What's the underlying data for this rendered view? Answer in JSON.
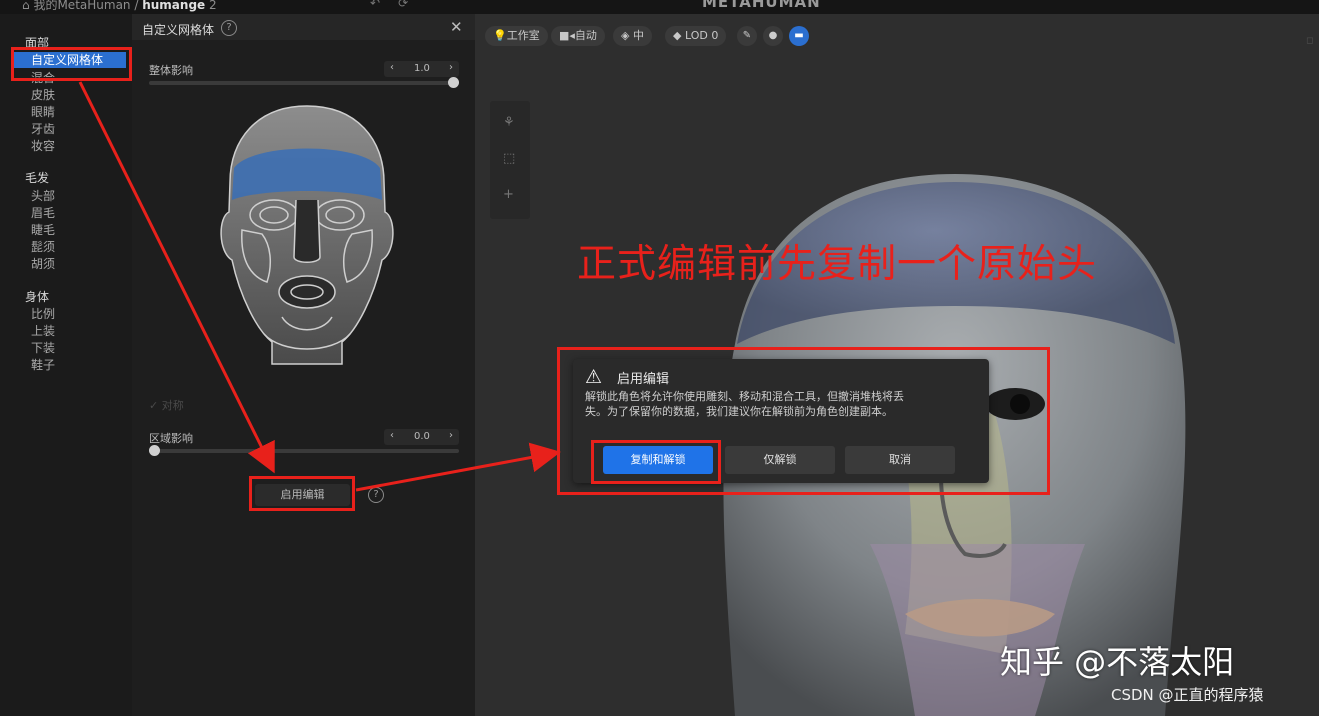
{
  "topbar": {
    "breadcrumb_project": "我的MetaHuman /",
    "breadcrumb_name": "humange",
    "version": "2",
    "undo_icon": "undo-icon",
    "redo_icon": "redo-icon",
    "brand": "METAHUMAN"
  },
  "sidebar": {
    "sections": [
      {
        "label": "面部",
        "items": [
          "自定义网格体",
          "混合",
          "皮肤",
          "眼睛",
          "牙齿",
          "妆容"
        ]
      },
      {
        "label": "毛发",
        "items": [
          "头部",
          "眉毛",
          "睫毛",
          "髭须",
          "胡须"
        ]
      },
      {
        "label": "身体",
        "items": [
          "比例",
          "上装",
          "下装",
          "鞋子"
        ]
      }
    ],
    "active_item": "自定义网格体"
  },
  "panel": {
    "title": "自定义网格体",
    "overall_label": "整体影响",
    "overall_value": "1.0",
    "overall_level": 1.0,
    "symmetry_label": "对称",
    "region_label": "区域影响",
    "region_value": "0.0",
    "region_level": 0.0,
    "enable_button": "启用编辑"
  },
  "viewport": {
    "toolbar": {
      "studio": "工作室",
      "auto": "自动",
      "quality": "中",
      "lod": "LOD 0"
    }
  },
  "dialog": {
    "title": "启用编辑",
    "message_line1": "解锁此角色将允许你使用雕刻、移动和混合工具，但撤消堆栈将丢",
    "message_line2": "失。为了保留你的数据，我们建议你在解锁前为角色创建副本。",
    "buttons": {
      "copy_unlock": "复制和解锁",
      "unlock_only": "仅解锁",
      "cancel": "取消"
    }
  },
  "annotation": {
    "text": "正式编辑前先复制一个原始头",
    "color": "#e8211b"
  },
  "watermark": {
    "zhihu": "知乎 @不落太阳",
    "csdn": "CSDN @正直的程序猿"
  },
  "colors": {
    "accent": "#2b6fd0",
    "primary_button": "#1f73e8",
    "annotation_red": "#e8211b"
  }
}
